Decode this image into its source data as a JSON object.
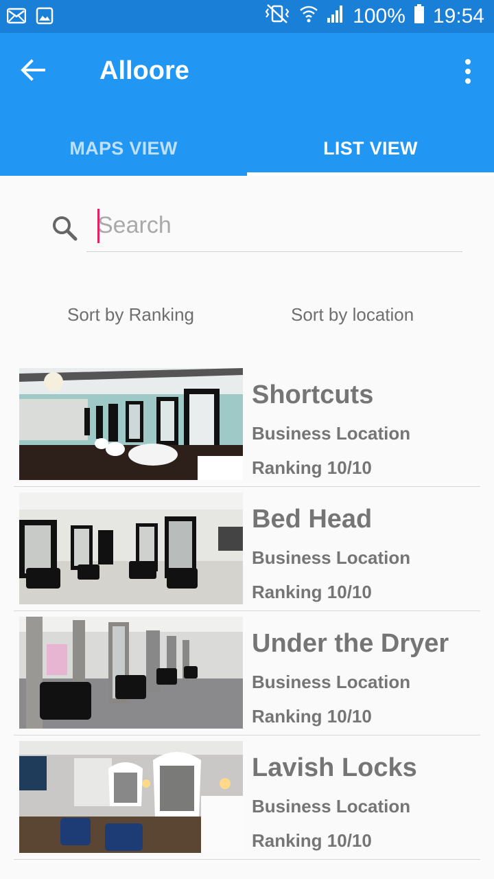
{
  "status_bar": {
    "battery": "100%",
    "time": "19:54",
    "icons": [
      "mail-icon",
      "image-icon",
      "vibrate-mute-icon",
      "wifi-icon",
      "signal-icon",
      "battery-icon"
    ]
  },
  "app_bar": {
    "title": "Alloore",
    "back_icon": "arrow-left-icon",
    "menu_icon": "more-vert-icon",
    "color": "#2196f3"
  },
  "tabs": [
    {
      "label": "MAPS VIEW",
      "selected": false
    },
    {
      "label": "LIST VIEW",
      "selected": true
    }
  ],
  "search": {
    "placeholder": "Search",
    "value": "",
    "caret_color": "#e91e63"
  },
  "sort": {
    "ranking_label": "Sort by Ranking",
    "location_label": "Sort by location"
  },
  "salons": [
    {
      "name": "Shortcuts",
      "location": "Business Location",
      "ranking": "Ranking 10/10"
    },
    {
      "name": "Bed Head",
      "location": "Business Location",
      "ranking": "Ranking 10/10"
    },
    {
      "name": "Under the Dryer",
      "location": "Business Location",
      "ranking": "Ranking 10/10"
    },
    {
      "name": "Lavish Locks",
      "location": "Business Location",
      "ranking": "Ranking 10/10"
    }
  ]
}
